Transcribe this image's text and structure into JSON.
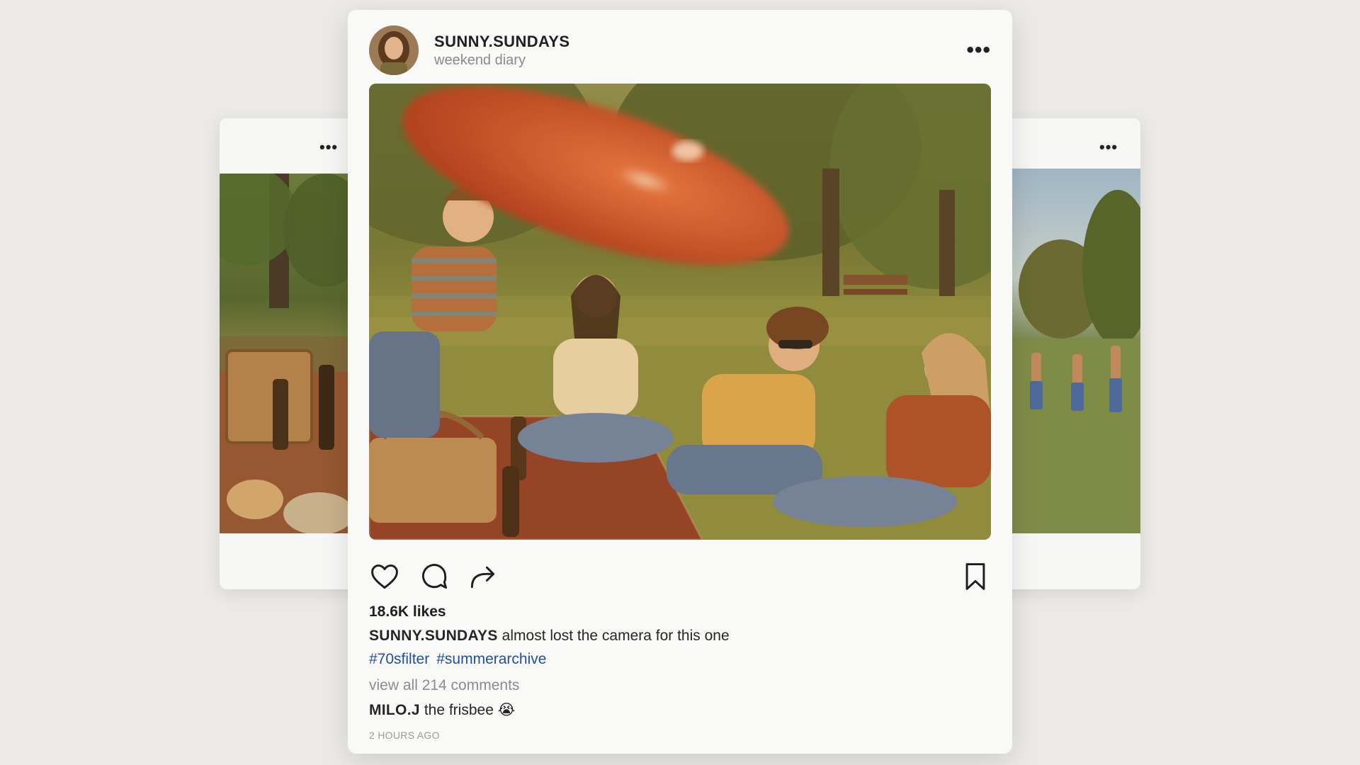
{
  "post": {
    "username": "SUNNY.SUNDAYS",
    "subtitle": "weekend diary",
    "likes": "18.6K likes",
    "caption_user": "SUNNY.SUNDAYS",
    "caption_text": "almost lost the camera for this one",
    "hashtags": [
      "#70sfilter",
      "#summerarchive"
    ],
    "view_comments": "view all 214 comments",
    "top_comment": {
      "user": "MILO.J",
      "text": "the frisbee 😭"
    },
    "timestamp": "2 HOURS AGO"
  },
  "icons": {
    "more": "more-dots-icon",
    "like": "heart-icon",
    "comment": "comment-bubble-icon",
    "share": "share-arrow-icon",
    "save": "bookmark-icon"
  },
  "colors": {
    "background": "#eceae7",
    "card": "#f9f9f8",
    "hashtag": "#1f4f9e",
    "muted_text": "#8c8c8c",
    "frisbee": "#d0552a"
  }
}
